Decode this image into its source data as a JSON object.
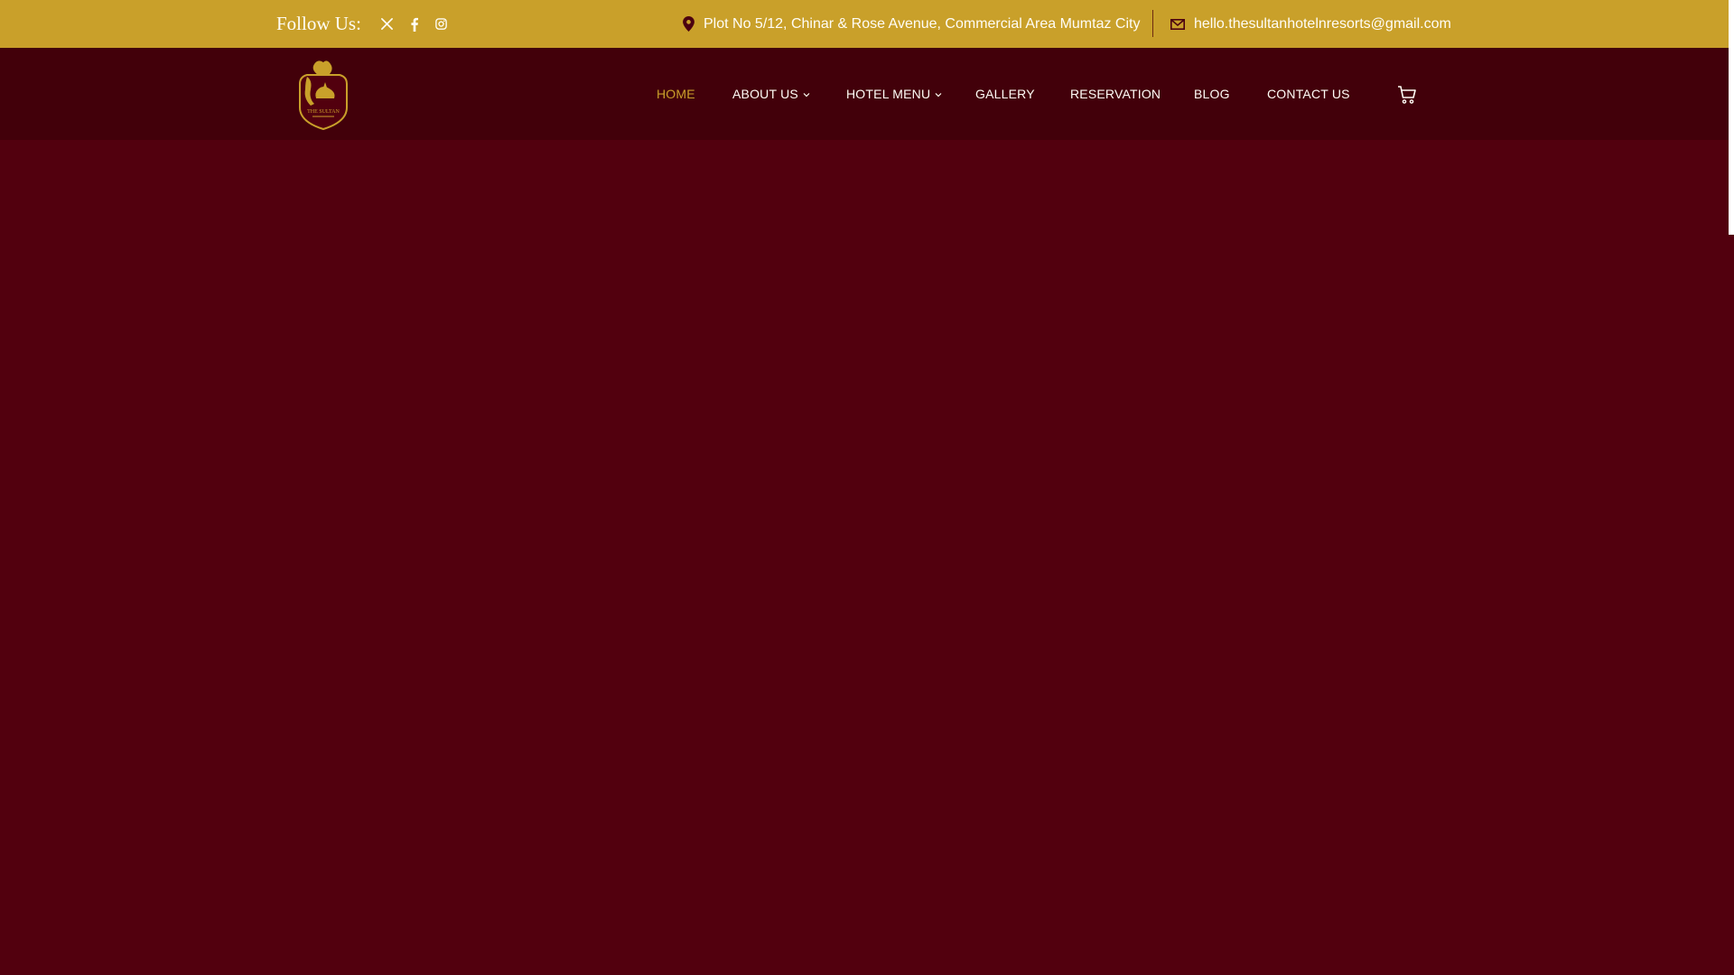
{
  "colors": {
    "topbar_bg": "#c9a02a",
    "header_bg": "#42000a",
    "page_bg": "#52000e",
    "nav_active": "#c9a02a",
    "text_light": "#fffdf6"
  },
  "topbar": {
    "follow_label": "Follow Us:",
    "social_icons": [
      "x-icon",
      "facebook-icon",
      "instagram-icon"
    ],
    "address": "Plot No 5/12, Chinar & Rose Avenue, Commercial Area Mumtaz City",
    "email": "hello.thesultanhotelnresorts@gmail.com"
  },
  "logo": {
    "text": "THE SULTAN"
  },
  "nav": {
    "items": [
      {
        "label": "HOME",
        "active": true
      },
      {
        "label": "ABOUT US",
        "has_dropdown": true
      },
      {
        "label": "HOTEL MENU",
        "has_dropdown": true
      },
      {
        "label": "GALLERY"
      },
      {
        "label": "RESERVATION"
      },
      {
        "label": "BLOG"
      },
      {
        "label": "CONTACT US"
      }
    ]
  }
}
